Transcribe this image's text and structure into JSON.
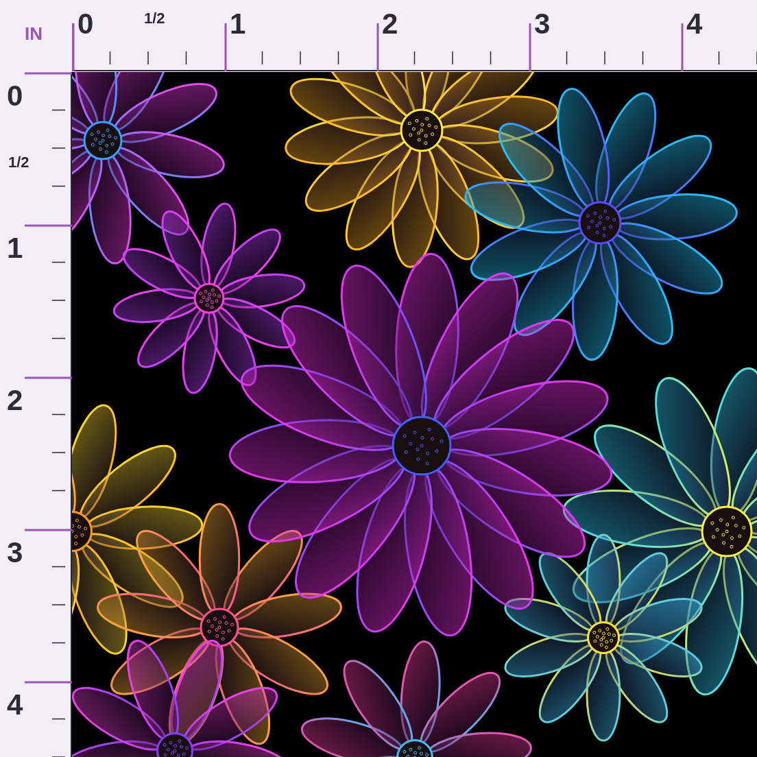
{
  "ruler_unit": "IN",
  "top_ruler": {
    "labels": [
      "0",
      "1/2",
      "1",
      "2",
      "3",
      "4"
    ]
  },
  "left_ruler": {
    "labels": [
      "0",
      "1/2",
      "1",
      "2",
      "3",
      "4"
    ]
  }
}
